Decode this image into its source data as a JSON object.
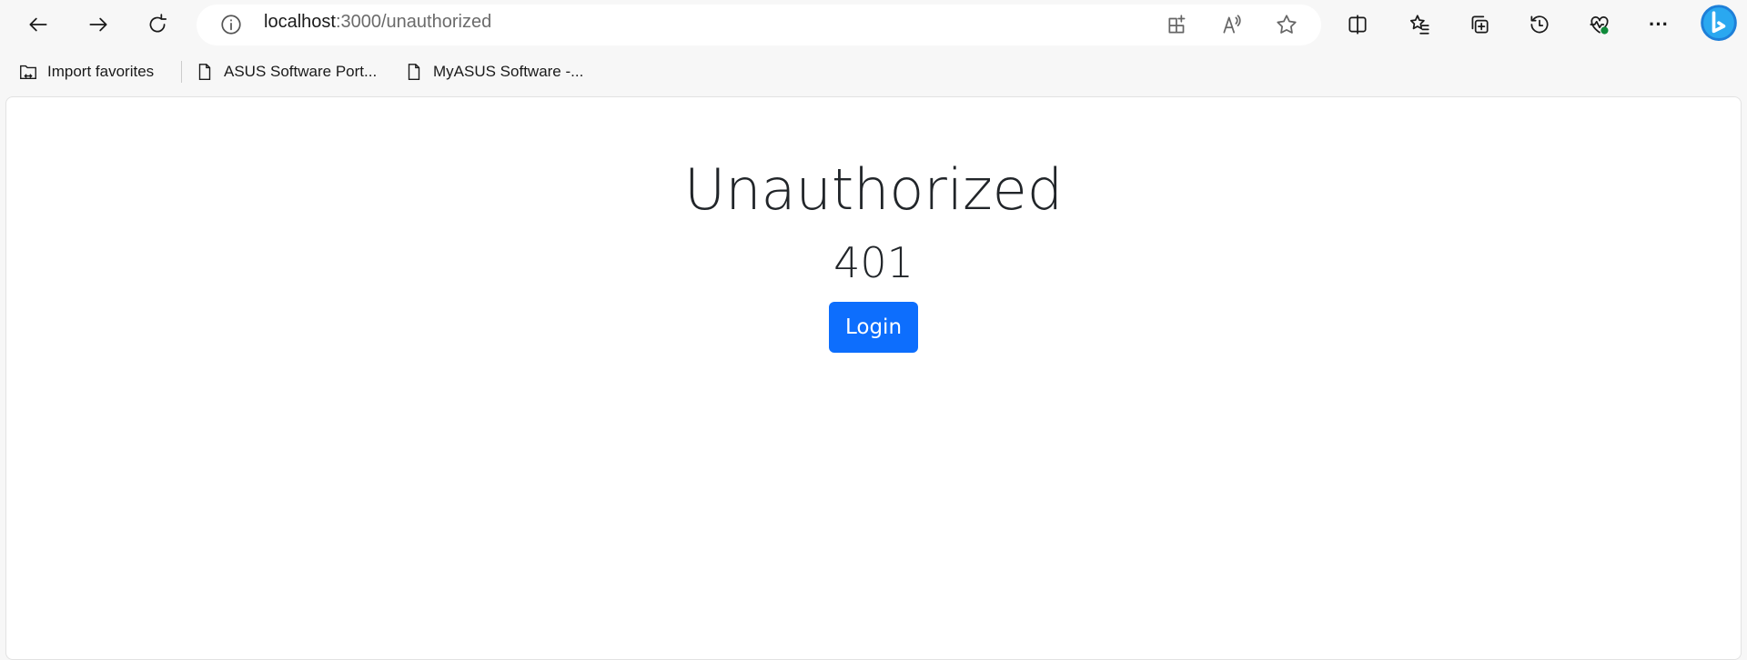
{
  "browser": {
    "url_host": "localhost",
    "url_rest": ":3000/unauthorized",
    "bookmarks": [
      {
        "label": "Import favorites",
        "icon": "import-folder-icon"
      },
      {
        "label": "ASUS Software Port...",
        "icon": "page-icon"
      },
      {
        "label": "MyASUS Software -...",
        "icon": "page-icon"
      }
    ]
  },
  "page": {
    "title": "Unauthorized",
    "code": "401",
    "login_label": "Login"
  },
  "colors": {
    "primary": "#0d6efd",
    "text": "#212529"
  }
}
